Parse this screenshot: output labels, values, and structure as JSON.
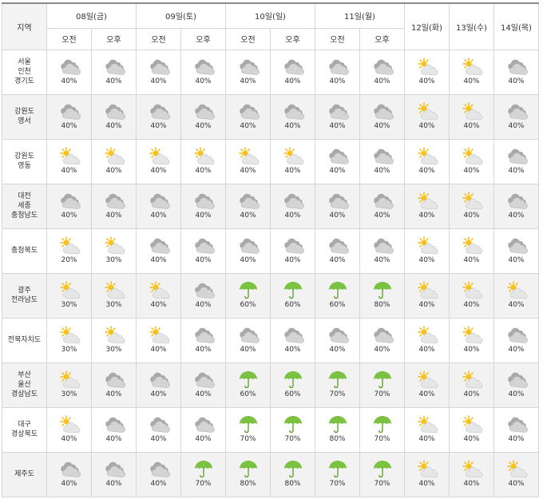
{
  "header": {
    "region_label": "지역",
    "days": [
      {
        "label": "08일(금)",
        "split": true
      },
      {
        "label": "09일(토)",
        "split": true
      },
      {
        "label": "10일(일)",
        "split": true
      },
      {
        "label": "11일(월)",
        "split": true
      },
      {
        "label": "12일(화)",
        "split": false
      },
      {
        "label": "13일(수)",
        "split": false
      },
      {
        "label": "14일(목)",
        "split": false
      }
    ],
    "am_label": "오전",
    "pm_label": "오후"
  },
  "rows": [
    {
      "region": [
        "서울",
        "인천",
        "경기도"
      ],
      "cells": [
        [
          "cloud",
          "40%"
        ],
        [
          "cloud",
          "40%"
        ],
        [
          "cloud",
          "40%"
        ],
        [
          "cloud",
          "40%"
        ],
        [
          "cloud",
          "40%"
        ],
        [
          "cloud",
          "40%"
        ],
        [
          "cloud",
          "40%"
        ],
        [
          "cloud",
          "40%"
        ],
        [
          "partly-sunny",
          "40%"
        ],
        [
          "partly-sunny",
          "40%"
        ],
        [
          "cloud",
          "40%"
        ]
      ]
    },
    {
      "region": [
        "강원도",
        "영서"
      ],
      "cells": [
        [
          "cloud",
          "40%"
        ],
        [
          "cloud",
          "40%"
        ],
        [
          "cloud",
          "40%"
        ],
        [
          "cloud",
          "40%"
        ],
        [
          "cloud",
          "40%"
        ],
        [
          "cloud",
          "40%"
        ],
        [
          "cloud",
          "40%"
        ],
        [
          "cloud",
          "40%"
        ],
        [
          "partly-sunny",
          "40%"
        ],
        [
          "partly-sunny",
          "40%"
        ],
        [
          "cloud",
          "40%"
        ]
      ]
    },
    {
      "region": [
        "강원도",
        "영동"
      ],
      "cells": [
        [
          "partly-sunny",
          "40%"
        ],
        [
          "partly-sunny",
          "40%"
        ],
        [
          "partly-sunny",
          "40%"
        ],
        [
          "partly-sunny",
          "40%"
        ],
        [
          "partly-sunny",
          "40%"
        ],
        [
          "partly-sunny",
          "40%"
        ],
        [
          "cloud",
          "40%"
        ],
        [
          "cloud",
          "40%"
        ],
        [
          "partly-sunny",
          "40%"
        ],
        [
          "partly-sunny",
          "40%"
        ],
        [
          "cloud",
          "40%"
        ]
      ]
    },
    {
      "region": [
        "대전",
        "세종",
        "충청남도"
      ],
      "cells": [
        [
          "cloud",
          "40%"
        ],
        [
          "cloud",
          "40%"
        ],
        [
          "cloud",
          "40%"
        ],
        [
          "cloud",
          "40%"
        ],
        [
          "cloud",
          "40%"
        ],
        [
          "cloud",
          "40%"
        ],
        [
          "cloud",
          "40%"
        ],
        [
          "cloud",
          "40%"
        ],
        [
          "partly-sunny",
          "40%"
        ],
        [
          "partly-sunny",
          "40%"
        ],
        [
          "cloud",
          "40%"
        ]
      ]
    },
    {
      "region": [
        "충청북도"
      ],
      "cells": [
        [
          "partly-sunny",
          "20%"
        ],
        [
          "partly-sunny",
          "30%"
        ],
        [
          "cloud",
          "40%"
        ],
        [
          "cloud",
          "40%"
        ],
        [
          "cloud",
          "40%"
        ],
        [
          "cloud",
          "40%"
        ],
        [
          "cloud",
          "40%"
        ],
        [
          "cloud",
          "40%"
        ],
        [
          "partly-sunny",
          "40%"
        ],
        [
          "partly-sunny",
          "40%"
        ],
        [
          "cloud",
          "40%"
        ]
      ]
    },
    {
      "region": [
        "광주",
        "전라남도"
      ],
      "cells": [
        [
          "partly-sunny",
          "30%"
        ],
        [
          "partly-sunny",
          "30%"
        ],
        [
          "partly-sunny",
          "40%"
        ],
        [
          "cloud",
          "40%"
        ],
        [
          "umbrella",
          "60%"
        ],
        [
          "umbrella",
          "60%"
        ],
        [
          "umbrella",
          "60%"
        ],
        [
          "umbrella",
          "80%"
        ],
        [
          "partly-sunny",
          "40%"
        ],
        [
          "partly-sunny",
          "40%"
        ],
        [
          "partly-sunny",
          "40%"
        ]
      ]
    },
    {
      "region": [
        "전북자치도"
      ],
      "cells": [
        [
          "partly-sunny",
          "30%"
        ],
        [
          "partly-sunny",
          "30%"
        ],
        [
          "partly-sunny",
          "40%"
        ],
        [
          "cloud",
          "40%"
        ],
        [
          "cloud",
          "40%"
        ],
        [
          "cloud",
          "40%"
        ],
        [
          "cloud",
          "40%"
        ],
        [
          "cloud",
          "40%"
        ],
        [
          "partly-sunny",
          "40%"
        ],
        [
          "partly-sunny",
          "40%"
        ],
        [
          "cloud",
          "40%"
        ]
      ]
    },
    {
      "region": [
        "부산",
        "울산",
        "경상남도"
      ],
      "cells": [
        [
          "partly-sunny",
          "30%"
        ],
        [
          "cloud",
          "40%"
        ],
        [
          "cloud",
          "40%"
        ],
        [
          "cloud",
          "40%"
        ],
        [
          "umbrella",
          "60%"
        ],
        [
          "umbrella",
          "60%"
        ],
        [
          "umbrella",
          "70%"
        ],
        [
          "umbrella",
          "70%"
        ],
        [
          "partly-sunny",
          "40%"
        ],
        [
          "partly-sunny",
          "40%"
        ],
        [
          "cloud",
          "40%"
        ]
      ]
    },
    {
      "region": [
        "대구",
        "경상북도"
      ],
      "cells": [
        [
          "partly-sunny",
          "40%"
        ],
        [
          "cloud",
          "40%"
        ],
        [
          "cloud",
          "40%"
        ],
        [
          "cloud",
          "40%"
        ],
        [
          "umbrella",
          "70%"
        ],
        [
          "umbrella",
          "70%"
        ],
        [
          "umbrella",
          "80%"
        ],
        [
          "umbrella",
          "70%"
        ],
        [
          "partly-sunny",
          "40%"
        ],
        [
          "partly-sunny",
          "40%"
        ],
        [
          "cloud",
          "40%"
        ]
      ]
    },
    {
      "region": [
        "제주도"
      ],
      "cells": [
        [
          "cloud",
          "40%"
        ],
        [
          "cloud",
          "40%"
        ],
        [
          "cloud",
          "40%"
        ],
        [
          "umbrella",
          "70%"
        ],
        [
          "umbrella",
          "80%"
        ],
        [
          "umbrella",
          "80%"
        ],
        [
          "umbrella",
          "70%"
        ],
        [
          "umbrella",
          "70%"
        ],
        [
          "partly-sunny",
          "40%"
        ],
        [
          "partly-sunny",
          "40%"
        ],
        [
          "partly-sunny",
          "40%"
        ]
      ]
    }
  ]
}
